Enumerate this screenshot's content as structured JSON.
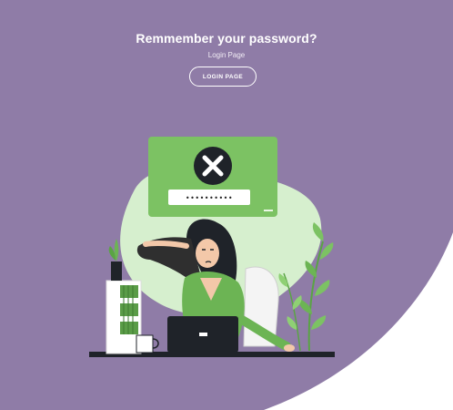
{
  "header": {
    "title": "Remmember your password?",
    "subtitle": "Login Page",
    "login_button_label": "LOGIN PAGE"
  },
  "illustration": {
    "masked_password": "••••••••••",
    "error_icon": "close-x-icon"
  },
  "colors": {
    "background_purple": "#8f7ca7",
    "accent_green": "#7cc263",
    "blob_green": "#d6efce",
    "white": "#ffffff"
  }
}
